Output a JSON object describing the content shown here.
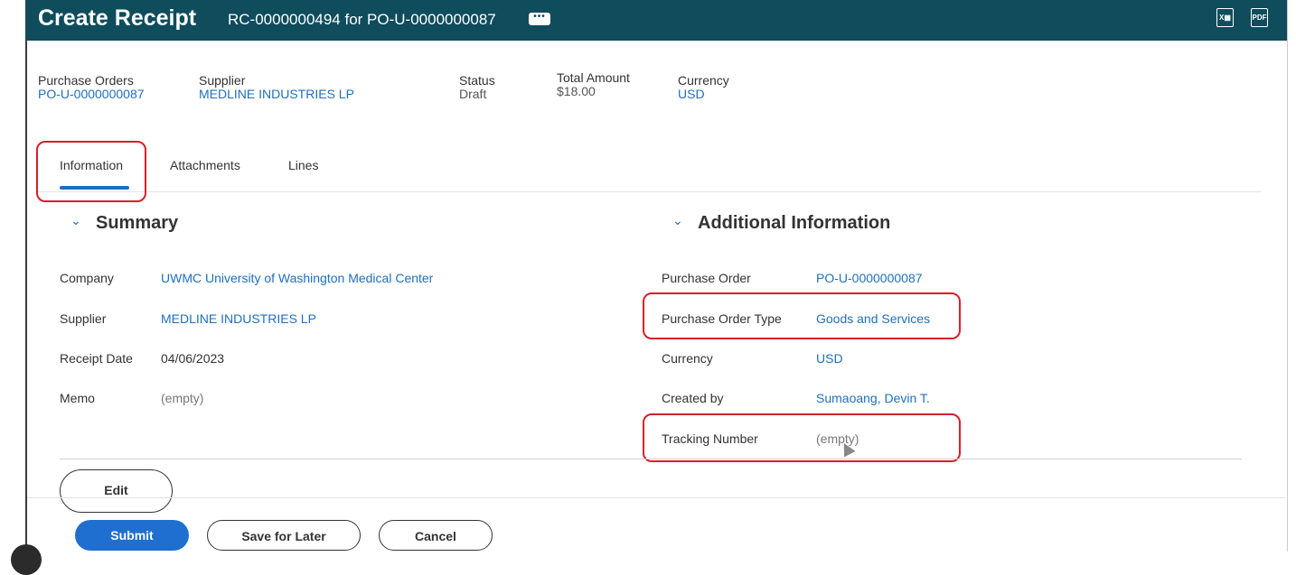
{
  "header": {
    "title": "Create Receipt",
    "subtitle": "RC-0000000494 for PO-U-0000000087",
    "more_icon": "ellipsis-icon",
    "excel_icon": "export-excel-icon",
    "pdf_icon": "export-pdf-icon"
  },
  "summary_bar": {
    "purchase_orders": {
      "label": "Purchase Orders",
      "value": "PO-U-0000000087"
    },
    "supplier": {
      "label": "Supplier",
      "value": "MEDLINE INDUSTRIES LP"
    },
    "status": {
      "label": "Status",
      "value": "Draft"
    },
    "total_amount": {
      "label": "Total Amount",
      "value": "$18.00"
    },
    "currency": {
      "label": "Currency",
      "value": "USD"
    }
  },
  "tabs": [
    {
      "label": "Information",
      "active": true
    },
    {
      "label": "Attachments",
      "active": false
    },
    {
      "label": "Lines",
      "active": false
    }
  ],
  "summary": {
    "heading": "Summary",
    "fields": [
      {
        "label": "Company",
        "value": "UWMC University of Washington Medical Center"
      },
      {
        "label": "Supplier",
        "value": "MEDLINE INDUSTRIES LP"
      },
      {
        "label": "Receipt Date",
        "value": "04/06/2023"
      },
      {
        "label": "Memo",
        "value": "(empty)"
      }
    ]
  },
  "additional": {
    "heading": "Additional Information",
    "fields": [
      {
        "label": "Purchase Order",
        "value": "PO-U-0000000087"
      },
      {
        "label": "Purchase Order Type",
        "value": "Goods and Services"
      },
      {
        "label": "Currency",
        "value": "USD"
      },
      {
        "label": "Created by",
        "value": "Sumaoang, Devin T."
      },
      {
        "label": "Tracking Number",
        "value": "(empty)"
      }
    ]
  },
  "actions": {
    "edit": "Edit",
    "submit": "Submit",
    "save_later": "Save for Later",
    "cancel": "Cancel"
  },
  "colors": {
    "header_bg": "#0f4c5c",
    "link": "#1f6fbf",
    "primary": "#1f6fd0",
    "highlight": "#d81e2a"
  }
}
